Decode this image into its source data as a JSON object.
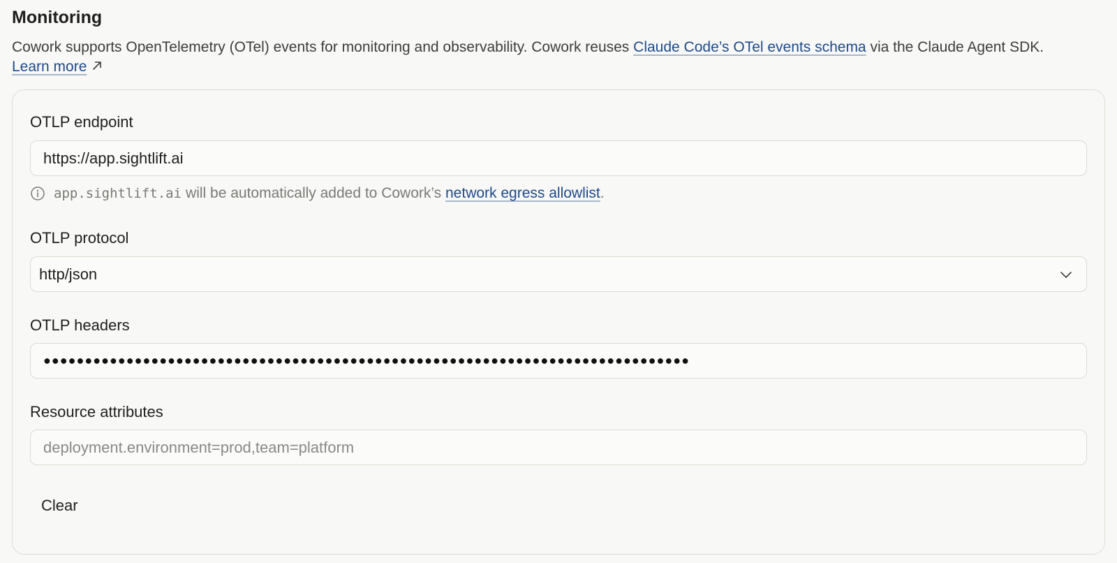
{
  "monitoring": {
    "title": "Monitoring",
    "description_prefix": "Cowork supports OpenTelemetry (OTel) events for monitoring and observability. Cowork reuses ",
    "schema_link": "Claude Code’s OTel events schema",
    "description_suffix": " via the Claude Agent SDK.",
    "learn_more": "Learn more"
  },
  "form": {
    "endpoint": {
      "label": "OTLP endpoint",
      "value": "https://app.sightlift.ai",
      "hint_domain": "app.sightlift.ai",
      "hint_text": "will be automatically added to Cowork’s ",
      "hint_link": "network egress allowlist",
      "hint_end": "."
    },
    "protocol": {
      "label": "OTLP protocol",
      "value": "http/json"
    },
    "headers": {
      "label": "OTLP headers",
      "masked_value": "●●●●●●●●●●●●●●●●●●●●●●●●●●●●●●●●●●●●●●●●●●●●●●●●●●●●●●●●●●●●●●●●●●●●●●●●●●●●●●"
    },
    "resource_attributes": {
      "label": "Resource attributes",
      "placeholder": "deployment.environment=prod,team=platform"
    },
    "clear_label": "Clear"
  },
  "icons": {
    "external": "external-link-icon",
    "info": "info-icon",
    "chevron": "chevron-down-icon"
  }
}
